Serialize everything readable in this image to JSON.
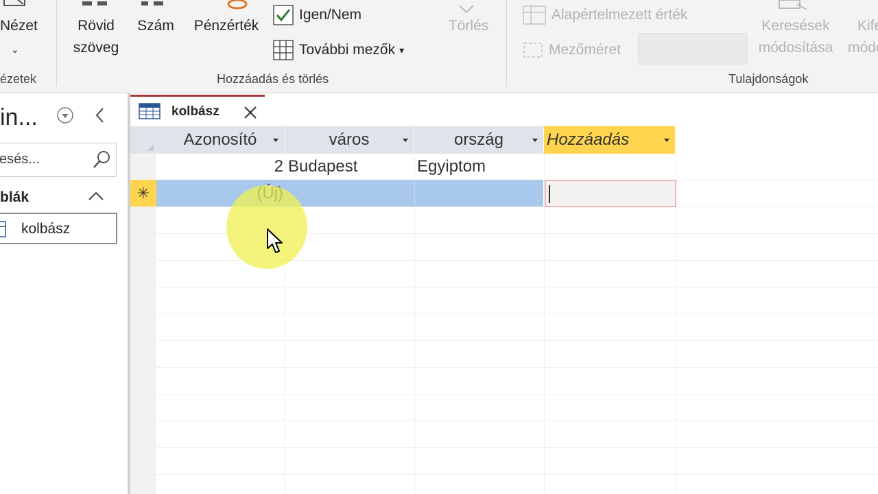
{
  "ribbon": {
    "nezet_label": "Nézet",
    "nezetek_group": "ézetek",
    "rovid_szoveg_line1": "Rövid",
    "rovid_szoveg_line2": "szöveg",
    "szam": "Szám",
    "penzertek": "Pénzérték",
    "igen_nem": "Igen/Nem",
    "tovabbi_mezok": "További mezők",
    "torles": "Törlés",
    "hozzaadas_torles_group": "Hozzáadás és törlés",
    "alapertelmezett_ertek": "Alapértelmezett érték",
    "mezomeret": "Mezőméret",
    "keresesek_line1": "Keresések",
    "keresesek_line2": "módosítása",
    "kife_line1": "Kife",
    "kife_line2": "módo",
    "tulajdonsagok_group": "Tulajdonságok"
  },
  "nav": {
    "title": "in...",
    "search_placeholder": "esés...",
    "section_label": "blák",
    "item_label": "kolbász"
  },
  "document_tab": {
    "label": "kolbász"
  },
  "datasheet": {
    "columns": [
      "Azonosító",
      "város",
      "ország",
      "Hozzáadás"
    ],
    "rows": [
      {
        "azonosito": "2",
        "varos": "Budapest",
        "orszag": "Egyiptom"
      }
    ],
    "new_row_marker": "✳",
    "new_row_label": "(Új)"
  },
  "colors": {
    "accent": "#a4373a",
    "new_row_highlight": "#a9c9ec",
    "add_column": "#ffd54f"
  }
}
